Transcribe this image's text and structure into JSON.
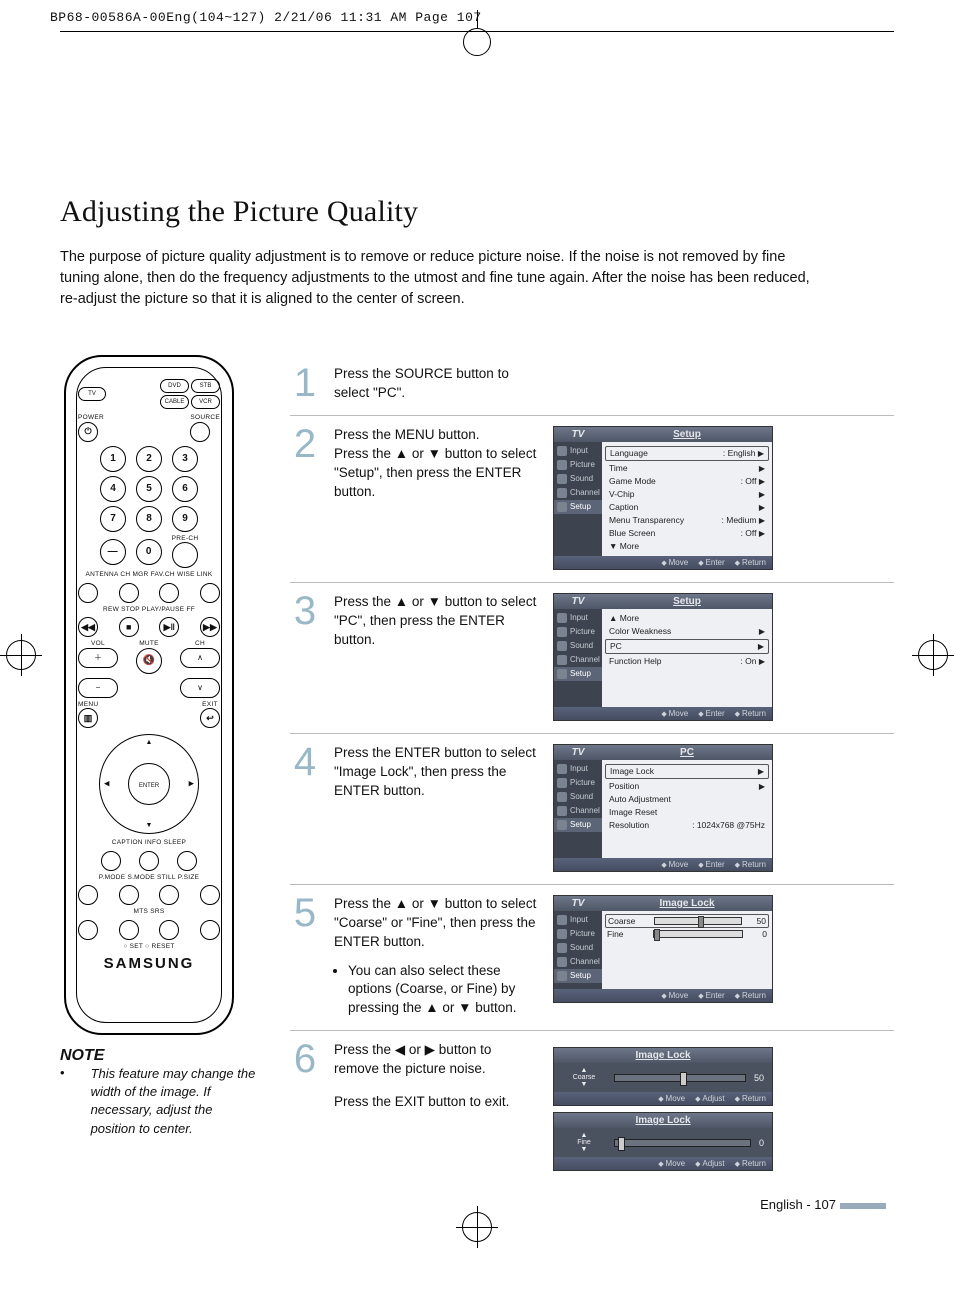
{
  "doc_header": "BP68-00586A-00Eng(104~127)  2/21/06  11:31 AM  Page 107",
  "title": "Adjusting the Picture Quality",
  "intro": "The purpose of picture quality adjustment is to remove or reduce picture noise. If the noise is not removed by fine tuning alone, then do the frequency adjustments to the utmost and fine tune again. After the noise has been reduced, re-adjust the picture so that it is aligned to the center of screen.",
  "remote": {
    "src_btns": [
      "DVD",
      "STB",
      "CABLE",
      "VCR"
    ],
    "tv": "TV",
    "power": "POWER",
    "source": "SOURCE",
    "numrow1": [
      "1",
      "2",
      "3"
    ],
    "numrow2": [
      "4",
      "5",
      "6"
    ],
    "numrow3": [
      "7",
      "8",
      "9"
    ],
    "dash": "—",
    "zero": "0",
    "prech": "PRE-CH",
    "labels_line": "ANTENNA  CH MGR   FAV.CH   WISE LINK",
    "transport": "REW   STOP   PLAY/PAUSE   FF",
    "vol": "VOL",
    "ch": "CH",
    "mute": "MUTE",
    "menu": "MENU",
    "exit": "EXIT",
    "enter": "ENTER",
    "row_cis": "CAPTION        INFO         SLEEP",
    "row_pss": "P.MODE   S.MODE   STILL   P.SIZE",
    "row_ms": "MTS      SRS",
    "row_sr": "○ SET    ○ RESET",
    "brand": "SAMSUNG"
  },
  "note": {
    "heading": "NOTE",
    "body": "This feature may change the width of the image. If necessary, adjust the position to center."
  },
  "steps": [
    {
      "n": "1",
      "text": "Press the SOURCE button to select \"PC\"."
    },
    {
      "n": "2",
      "text": "Press the MENU button.\nPress the ▲ or ▼ button to select \"Setup\", then press the ENTER button."
    },
    {
      "n": "3",
      "text": "Press the ▲ or ▼ button to select \"PC\", then press the ENTER button."
    },
    {
      "n": "4",
      "text": "Press the ENTER button to select \"Image Lock\", then press the ENTER button."
    },
    {
      "n": "5",
      "text": "Press the ▲ or ▼ button to select \"Coarse\" or \"Fine\", then press the ENTER button.",
      "bullet": "You can also select these options (Coarse, or Fine) by pressing the ▲ or ▼ button."
    },
    {
      "n": "6",
      "text": "Press the ◀ or ▶ button to remove the picture noise.",
      "extra": "Press the EXIT button to exit."
    }
  ],
  "osd_side": [
    "Input",
    "Picture",
    "Sound",
    "Channel",
    "Setup"
  ],
  "osd_footer": {
    "move": "Move",
    "enter": "Enter",
    "return": "Return",
    "adjust": "Adjust"
  },
  "screens": {
    "s2": {
      "tv": "TV",
      "title": "Setup",
      "rows": [
        {
          "l": "Language",
          "r": ": English",
          "boxed": true,
          "a": "▶"
        },
        {
          "l": "Time",
          "r": "",
          "a": "▶"
        },
        {
          "l": "Game Mode",
          "r": ": Off",
          "a": "▶"
        },
        {
          "l": "V-Chip",
          "r": "",
          "a": "▶"
        },
        {
          "l": "Caption",
          "r": "",
          "a": "▶"
        },
        {
          "l": "Menu Transparency",
          "r": ": Medium",
          "a": "▶"
        },
        {
          "l": "Blue Screen",
          "r": ": Off",
          "a": "▶"
        },
        {
          "l": "▼ More",
          "r": "",
          "a": ""
        }
      ]
    },
    "s3": {
      "tv": "TV",
      "title": "Setup",
      "rows": [
        {
          "l": "▲ More",
          "r": "",
          "a": ""
        },
        {
          "l": "Color Weakness",
          "r": "",
          "a": "▶"
        },
        {
          "l": "PC",
          "r": "",
          "boxed": true,
          "a": "▶"
        },
        {
          "l": "Function Help",
          "r": ": On",
          "a": "▶"
        }
      ]
    },
    "s4": {
      "tv": "TV",
      "title": "PC",
      "rows": [
        {
          "l": "Image Lock",
          "r": "",
          "boxed": true,
          "a": "▶"
        },
        {
          "l": "Position",
          "r": "",
          "a": "▶"
        },
        {
          "l": "Auto Adjustment",
          "r": "",
          "a": ""
        },
        {
          "l": "Image Reset",
          "r": "",
          "a": ""
        },
        {
          "l": "Resolution",
          "r": ": 1024x768 @75Hz",
          "a": ""
        }
      ]
    },
    "s5": {
      "tv": "TV",
      "title": "Image Lock",
      "sliders": [
        {
          "l": "Coarse",
          "v": "50",
          "pos": 50,
          "boxed": true
        },
        {
          "l": "Fine",
          "v": "0",
          "pos": 0
        }
      ]
    },
    "s6a": {
      "title": "Image Lock",
      "label": "Coarse",
      "v": "50",
      "pos": 50
    },
    "s6b": {
      "title": "Image Lock",
      "label": "Fine",
      "v": "0",
      "pos": 2
    }
  },
  "footer": "English - 107"
}
